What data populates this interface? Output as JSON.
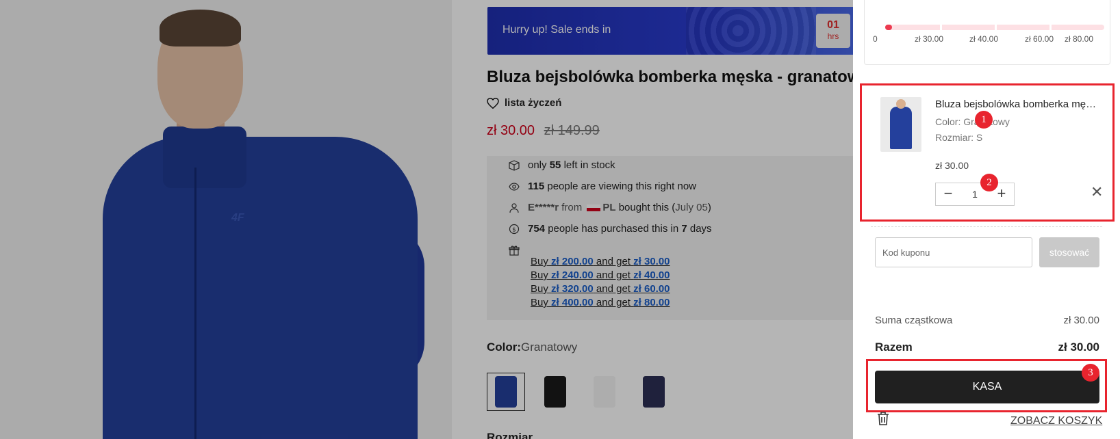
{
  "product": {
    "sale_banner": {
      "text": "Hurry up!  Sale ends in",
      "timer_value": "01",
      "timer_unit": "hrs"
    },
    "title": "Bluza bejsbolówka bomberka męska - granatowa",
    "wishlist_label": "lista życzeń",
    "price_now": "zł 30.00",
    "price_old": "zł 149.99",
    "stock": {
      "prefix": "only",
      "count": "55",
      "suffix": "left in stock"
    },
    "viewers": {
      "count": "115",
      "suffix": "people are viewing this right now"
    },
    "recent_buyer": {
      "name": "E*****r",
      "from": "from",
      "country": "PL",
      "bought": "bought this (",
      "date": "July 05",
      "close": ")"
    },
    "purchases": {
      "count": "754",
      "mid": "people has purchased this in",
      "days": "7",
      "suffix": "days"
    },
    "offers": [
      {
        "buy": "Buy",
        "amount": "zł 200.00",
        "get": "and get",
        "reward": "zł 30.00"
      },
      {
        "buy": "Buy",
        "amount": "zł 240.00",
        "get": "and get",
        "reward": "zł 40.00"
      },
      {
        "buy": "Buy",
        "amount": "zł 320.00",
        "get": "and get",
        "reward": "zł 60.00"
      },
      {
        "buy": "Buy",
        "amount": "zł 400.00",
        "get": "and get",
        "reward": "zł 80.00"
      }
    ],
    "color_label": "Color:",
    "color_value": "Granatowy",
    "swatches": [
      {
        "color": "#24409c"
      },
      {
        "color": "#1a1a1a"
      },
      {
        "color": "#f4f4f4"
      },
      {
        "color": "#2c2f55"
      }
    ],
    "size_label": "Rozmiar"
  },
  "cart": {
    "progress": {
      "fill_fraction": 0.03,
      "ticks": [
        "0",
        "zł 30.00",
        "zł 40.00",
        "zł 60.00",
        "zł 80.00"
      ]
    },
    "item": {
      "name": "Bluza bejsbolówka bomberka męska - granatowa",
      "color": "Color: Granatowy",
      "size": "Rozmiar: S",
      "price": "zł 30.00",
      "quantity": "1"
    },
    "coupon": {
      "placeholder": "Kod kuponu",
      "apply_label": "stosować"
    },
    "subtotal_label": "Suma cząstkowa",
    "subtotal_value": "zł 30.00",
    "total_label": "Razem",
    "total_value": "zł 30.00",
    "checkout_label": "KASA",
    "view_cart_label": "ZOBACZ KOSZYK"
  },
  "annotations": {
    "badge_1": "1",
    "badge_2": "2",
    "badge_3": "3"
  },
  "colors": {
    "accent_red": "#e8242e",
    "price_red": "#d0021b",
    "progress_pink": "#ec3a4f",
    "checkout_dark": "#202020"
  }
}
